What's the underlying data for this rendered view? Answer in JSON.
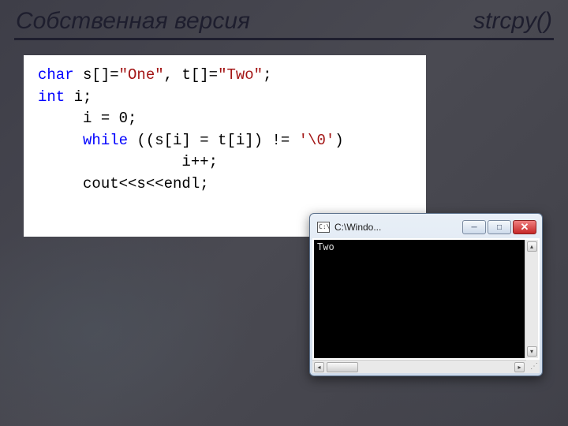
{
  "header": {
    "left": "Собственная версия",
    "right": "strcpy()"
  },
  "code": {
    "l1_kw": "char",
    "l1_a": " s[]=",
    "l1_s1": "\"One\"",
    "l1_b": ", t[]=",
    "l1_s2": "\"Two\"",
    "l1_c": ";",
    "l2_kw": "int",
    "l2_a": " i;",
    "l3": "     i = 0;",
    "l4_a": "     ",
    "l4_kw": "while",
    "l4_b": " ((s[i] = t[i]) != ",
    "l4_chr": "'\\0'",
    "l4_c": ")",
    "l5": "                i++;",
    "l6": "",
    "l7": "     cout<<s<<endl;"
  },
  "console": {
    "icon_text": "C:\\",
    "title": "C:\\Windo...",
    "min_glyph": "─",
    "max_glyph": "□",
    "close_glyph": "✕",
    "output": "Two",
    "up": "▴",
    "down": "▾",
    "left": "◂",
    "right": "▸",
    "grip": "⋰"
  }
}
